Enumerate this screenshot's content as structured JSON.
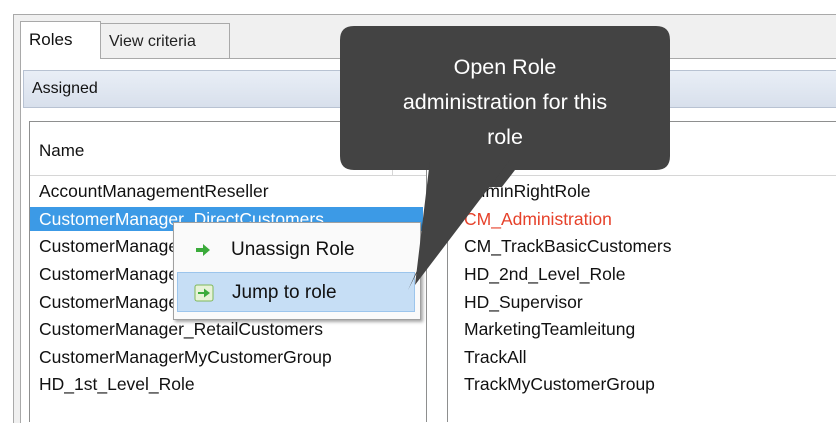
{
  "tabs": [
    {
      "label": "Roles",
      "active": true
    },
    {
      "label": "View criteria",
      "active": false
    }
  ],
  "panel": {
    "title": "Assigned"
  },
  "left_list": {
    "column_header": "Name",
    "rows": [
      "AccountManagementReseller",
      "CustomerManager_DirectCustomers",
      "CustomerManager_DirectCustomersLarge",
      "CustomerManager_RetailCompanies",
      "CustomerManager_RetailCompanies",
      "CustomerManager_RetailCustomers",
      "CustomerManagerMyCustomerGroup",
      "HD_1st_Level_Role"
    ],
    "selected_index": 1
  },
  "right_list": {
    "rows": [
      "AdminRightRole",
      "CM_Administration",
      "CM_TrackBasicCustomers",
      "HD_2nd_Level_Role",
      "HD_Supervisor",
      "MarketingTeamleitung",
      "TrackAll",
      "TrackMyCustomerGroup"
    ],
    "highlight_index": 1,
    "highlight_color": "#e6412a"
  },
  "context_menu": {
    "items": [
      {
        "label": "Unassign Role",
        "icon": "arrow-right-icon",
        "highlighted": false
      },
      {
        "label": "Jump to role",
        "icon": "jump-arrow-icon",
        "highlighted": true
      }
    ]
  },
  "tooltip": {
    "lines": [
      "Open Role",
      "administration for this",
      "role"
    ]
  },
  "colors": {
    "selection": "#3c9ae6",
    "menu_highlight": "#c6def5",
    "tooltip_bg": "#434343",
    "icon_green": "#3bab3b"
  }
}
